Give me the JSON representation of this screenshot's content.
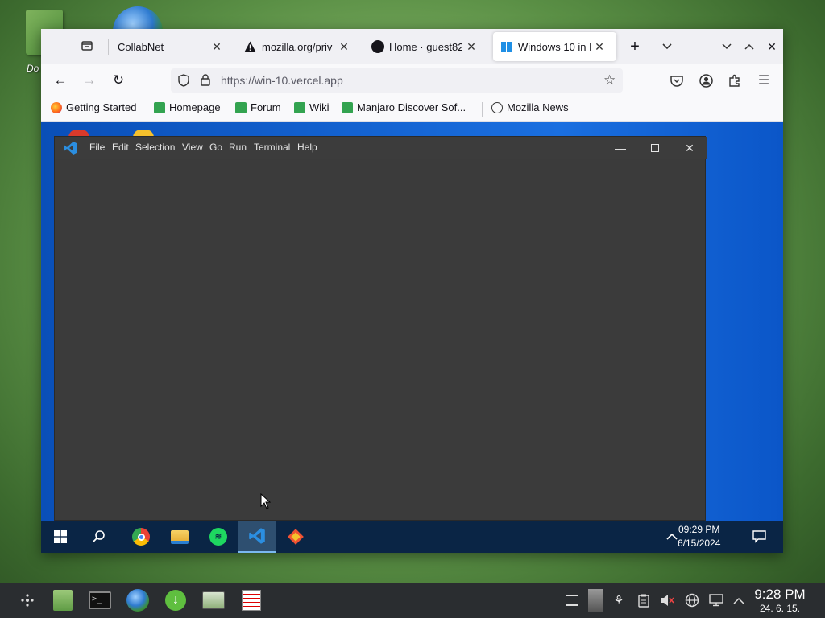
{
  "desktop": {
    "label": "Do"
  },
  "browser": {
    "tabs": [
      {
        "title": "CollabNet",
        "icon": "collabnet-icon"
      },
      {
        "title": "mozilla.org/priv",
        "icon": "warning-icon"
      },
      {
        "title": "Home · guest82",
        "icon": "github-icon"
      },
      {
        "title": "Windows 10 in B",
        "icon": "windows-icon"
      }
    ],
    "url": "https://win-10.vercel.app",
    "bookmarks": [
      {
        "label": "Getting Started",
        "icon": "firefox-icon"
      },
      {
        "label": "Homepage",
        "icon": "manjaro-icon"
      },
      {
        "label": "Forum",
        "icon": "manjaro-icon"
      },
      {
        "label": "Wiki",
        "icon": "manjaro-icon"
      },
      {
        "label": "Manjaro Discover Sof...",
        "icon": "manjaro-icon"
      },
      {
        "label": "Mozilla News",
        "icon": "globe-icon"
      }
    ]
  },
  "vscode": {
    "menu": [
      "File",
      "Edit",
      "Selection",
      "View",
      "Go",
      "Run",
      "Terminal",
      "Help"
    ]
  },
  "win_taskbar": {
    "time": "09:29 PM",
    "date": "6/15/2024"
  },
  "panel": {
    "time": "9:28 PM",
    "date": "24. 6. 15."
  }
}
